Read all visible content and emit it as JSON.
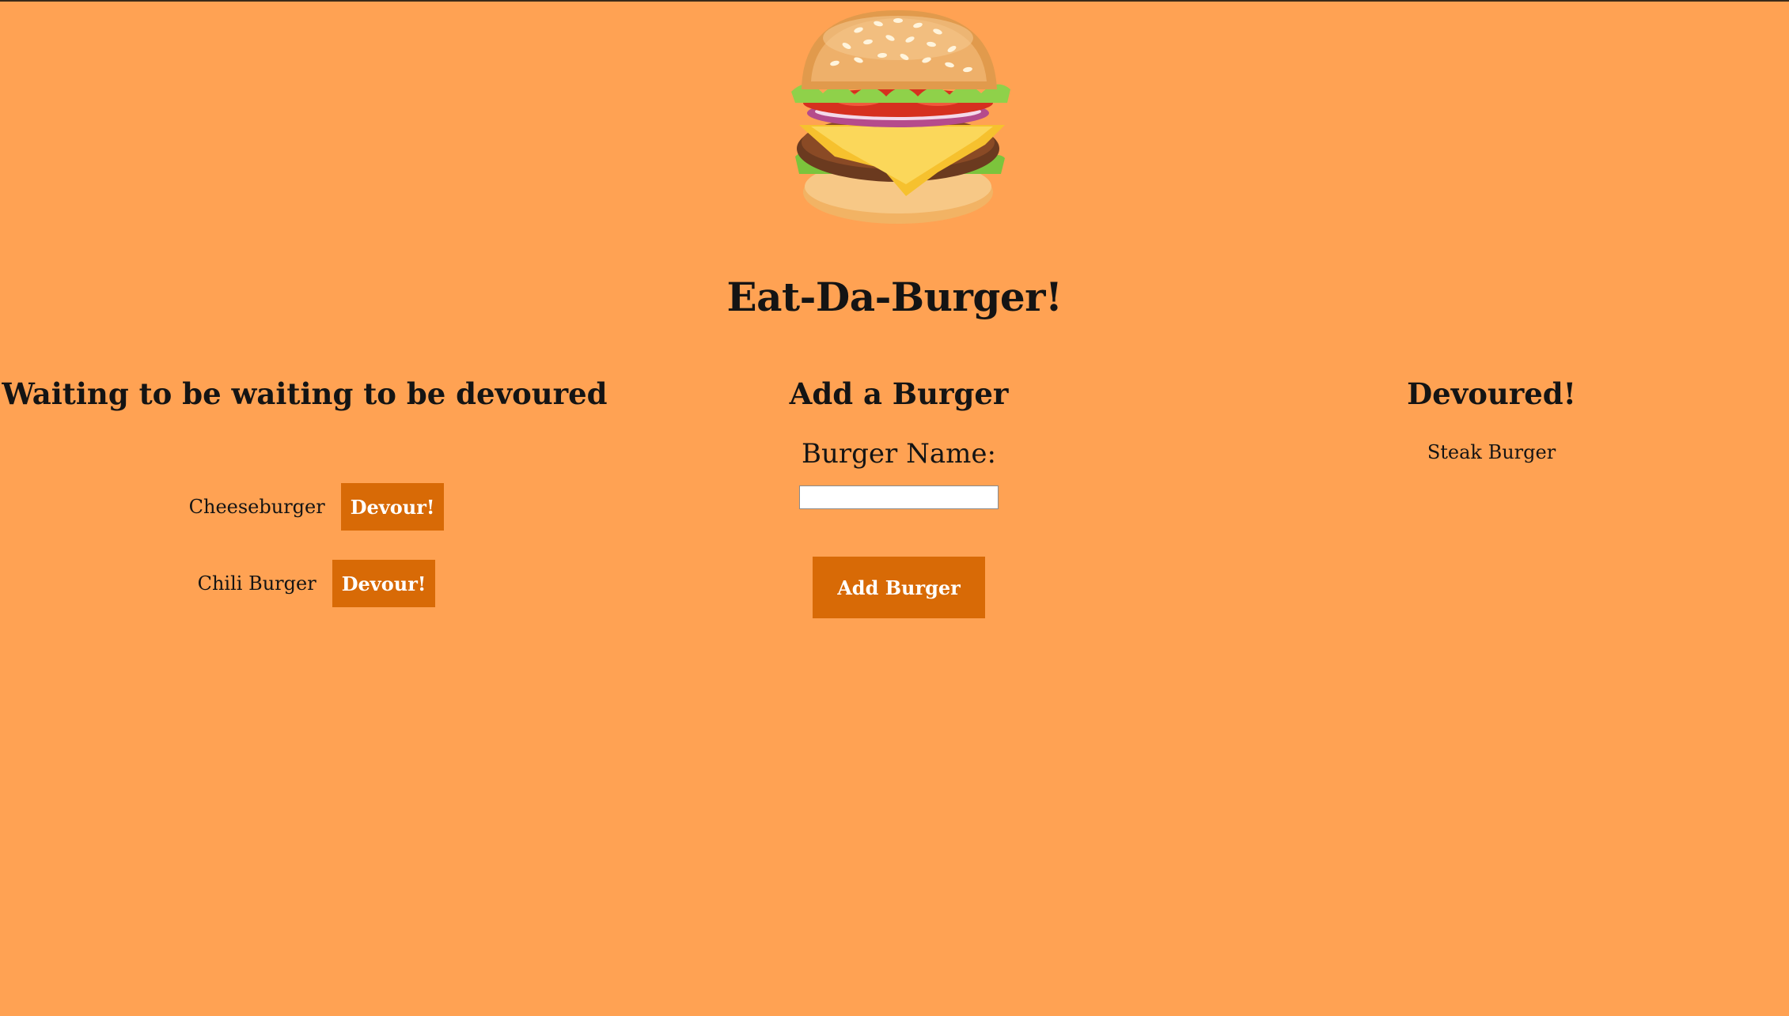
{
  "header": {
    "title": "Eat-Da-Burger!",
    "logo_icon": "burger-icon"
  },
  "waiting": {
    "heading": "Waiting to be waiting to be devoured",
    "items": [
      {
        "name": "Cheeseburger",
        "button_label": "Devour!"
      },
      {
        "name": "Chili Burger",
        "button_label": "Devour!"
      }
    ]
  },
  "add_form": {
    "heading": "Add a Burger",
    "label": "Burger Name:",
    "input_value": "",
    "button_label": "Add Burger"
  },
  "devoured": {
    "heading": "Devoured!",
    "items": [
      {
        "name": "Steak Burger"
      }
    ]
  },
  "colors": {
    "background": "#ffa253",
    "button": "#d86a06",
    "button_text": "#ffffff",
    "text": "#141414"
  }
}
